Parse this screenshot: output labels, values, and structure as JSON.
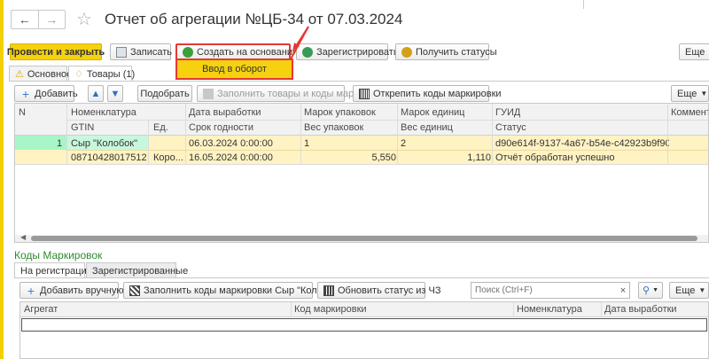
{
  "window": {
    "title": "Отчет об агрегации №ЦБ-34 от 07.03.2024",
    "back_icon": "arrow-left-icon",
    "forward_icon": "arrow-right-icon",
    "star_icon": "star-icon"
  },
  "toolbar": {
    "post_close": "Провести и закрыть",
    "save": "Записать",
    "create_based": "Создать на основании",
    "register": "Зарегистрировать",
    "get_statuses": "Получить статусы",
    "more": "Еще"
  },
  "dropdown": {
    "item": "Ввод в оборот"
  },
  "tabs": {
    "main": "Основное",
    "goods": "Товары (1)"
  },
  "goods_toolbar": {
    "add": "Добавить",
    "select": "Подобрать",
    "fill": "Заполнить товары и коды марок",
    "detach": "Открепить коды маркировки",
    "more": "Еще"
  },
  "goods_table": {
    "headers_row1": {
      "n": "N",
      "nomenclature": "Номенклатура",
      "production_date": "Дата выработки",
      "package_label": "Марок упаковок",
      "unit_label": "Марок единиц",
      "guid": "ГУИД",
      "comment": "Комментар"
    },
    "headers_row2": {
      "gtin": "GTIN",
      "unit": "Ед.",
      "shelf_life": "Срок годности",
      "package_weight": "Вес упаковок",
      "unit_weight": "Вес единиц",
      "status": "Статус"
    },
    "row": {
      "n": "1",
      "nomenclature": "Сыр \"Колобок\"",
      "production_date": "06.03.2024 0:00:00",
      "package_marks": "1",
      "unit_marks": "2",
      "guid": "d90e614f-9137-4a67-b54e-c42923b9f90",
      "gtin": "08710428017512",
      "unit": "Коро...",
      "shelf_life": "16.05.2024 0:00:00",
      "package_weight": "5,550",
      "unit_weight": "1,110",
      "status": "Отчёт обработан успешно"
    }
  },
  "codes": {
    "title": "Коды Маркировок",
    "tab_registration": "На регистрацию",
    "tab_registered": "Зарегистрированные",
    "add_manual": "Добавить вручную",
    "fill_codes": "Заполнить коды маркировки Сыр \"Колобок\"",
    "update_status": "Обновить статус из ЧЗ",
    "search_placeholder": "Поиск (Ctrl+F)",
    "more": "Еще",
    "headers": {
      "aggregate": "Агрегат",
      "code": "Код маркировки",
      "nomenclature": "Номенклатура",
      "production_date": "Дата выработки"
    }
  },
  "colors": {
    "accent_yellow": "#f5d10f",
    "annotation_red": "#e53935",
    "row_selected": "#fff3c4",
    "row_green": "#a8f5c8",
    "section_green": "#2e8b2e"
  }
}
